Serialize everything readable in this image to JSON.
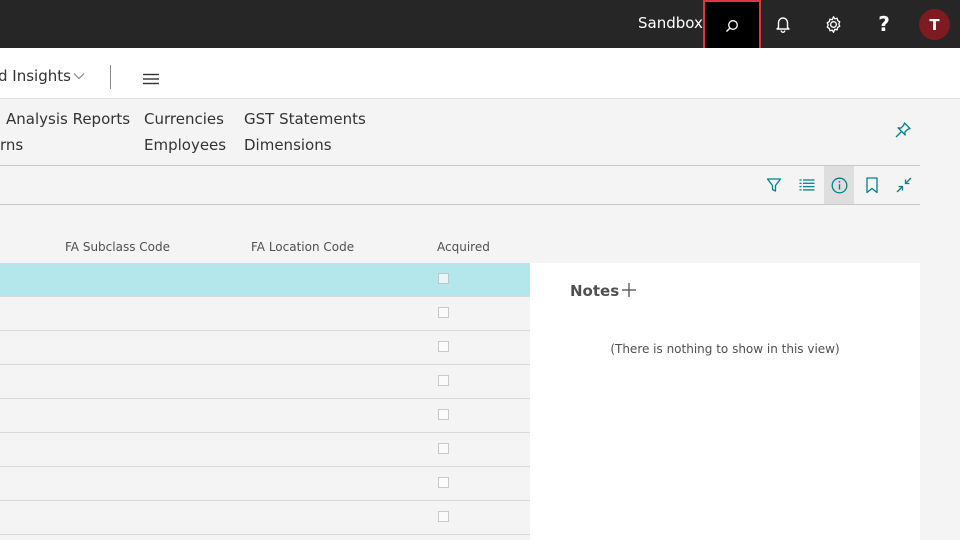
{
  "topbar": {
    "environment": "Sandbox",
    "avatar_initial": "T"
  },
  "navbar": {
    "title": "d Insights"
  },
  "links": {
    "col1_row1": "Analysis Reports",
    "col1_row2": "rns",
    "col2_row1": "Currencies",
    "col2_row2": "Employees",
    "col3_row1": "GST Statements",
    "col3_row2": "Dimensions"
  },
  "list": {
    "columns": {
      "subclass": "FA Subclass Code",
      "location": "FA Location Code",
      "acquired": "Acquired"
    },
    "rows": [
      {
        "acquired": false,
        "selected": true
      },
      {
        "acquired": false
      },
      {
        "acquired": false
      },
      {
        "acquired": false
      },
      {
        "acquired": false
      },
      {
        "acquired": false
      },
      {
        "acquired": false
      },
      {
        "acquired": false
      }
    ]
  },
  "factbox": {
    "notes_title": "Notes",
    "empty_message": "(There is nothing to show in this view)"
  },
  "colors": {
    "topbar": "#262626",
    "accent": "#00838f",
    "selected_row": "#b3e7ec",
    "avatar": "#7d1a22",
    "highlight": "#e0353f"
  }
}
